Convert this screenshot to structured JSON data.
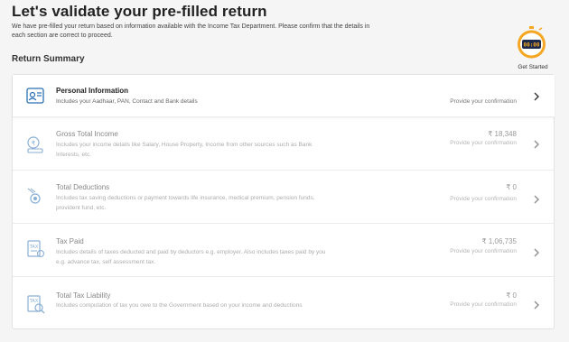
{
  "page": {
    "title": "Let's validate your pre-filled return",
    "subtitle": "We have pre-filled your return based on information available with the Income Tax Department. Please confirm that the details in each section are correct to proceed.",
    "section_title": "Return Summary"
  },
  "timer": {
    "display": "00:00",
    "label": "Get Started"
  },
  "rows": [
    {
      "icon": "id-card-icon",
      "name": "Personal Information",
      "description": "Includes your Aadhaar, PAN, Contact and Bank details",
      "amount": "",
      "status": "Provide your confirmation"
    },
    {
      "icon": "rupee-coins-icon",
      "name": "Gross Total Income",
      "description": "Includes your income details like Salary, House Property, Income from other sources such as Bank Interests, etc.",
      "amount": "₹ 18,348",
      "status": "Provide your confirmation"
    },
    {
      "icon": "deduction-coin-icon",
      "name": "Total Deductions",
      "description": "Includes tax saving deductions or payment towards life insurance, medical premium, pension funds, provident fund, etc.",
      "amount": "₹ 0",
      "status": "Provide your confirmation"
    },
    {
      "icon": "tax-document-icon",
      "name": "Tax Paid",
      "description": "Includes details of taxes deducted and paid by deductors e.g. employer. Also includes taxes paid by you e.g. advance tax, self assessment tax.",
      "amount": "₹ 1,06,735",
      "status": "Provide your confirmation"
    },
    {
      "icon": "tax-calculator-icon",
      "name": "Total Tax Liability",
      "description": "Includes computation of tax you owe to the Government based on your income and deductions",
      "amount": "₹ 0",
      "status": "Provide your confirmation"
    }
  ],
  "colors": {
    "accent": "#2b6fb3",
    "timer_orange": "#f5a623",
    "timer_bg": "#1e2a4a"
  }
}
